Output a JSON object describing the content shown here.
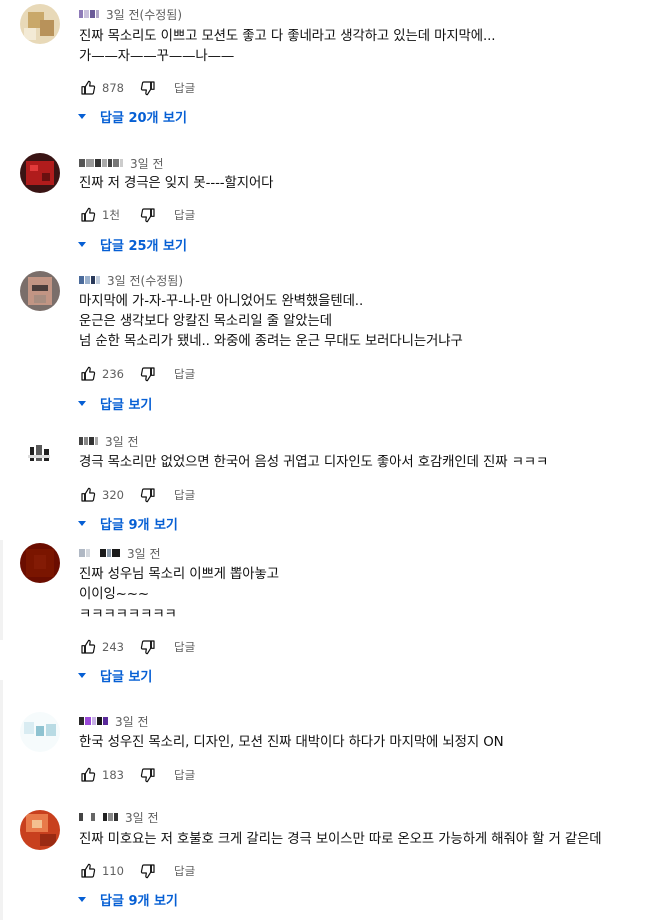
{
  "comments": [
    {
      "time": "3일 전(수정됨)",
      "text": "진짜 목소리도 이쁘고 모션도 좋고 다 좋네라고 생각하고 있는데 마지막에...\n가——자——꾸——나——",
      "likes": "878",
      "reply_label": "답글",
      "replies_label": "답글 20개 보기",
      "avatar_colors": [
        "#e8d9b8",
        "#c9a86a",
        "#f3ead5",
        "#b8925a"
      ]
    },
    {
      "time": "3일 전",
      "text": "진짜 저 경극은 잊지 못----할지어다",
      "likes": "1천",
      "reply_label": "답글",
      "replies_label": "답글 25개 보기",
      "avatar_colors": [
        "#3a1414",
        "#b01c1c",
        "#e23a3a",
        "#6a1010"
      ]
    },
    {
      "time": "3일 전(수정됨)",
      "text": "마지막에 가-자-꾸-나-만 아니었어도 완벽했을텐데..\n운근은 생각보다 앙칼진 목소리일 줄 알았는데\n넘 순한 목소리가 됐네.. 와중에 종려는 운근 무대도 보러다니는거냐구",
      "likes": "236",
      "reply_label": "답글",
      "replies_label": "답글 보기",
      "avatar_colors": [
        "#7a6e6a",
        "#c29584",
        "#4a3d3b",
        "#a88d80"
      ]
    },
    {
      "time": "3일 전",
      "text": "경극 목소리만 없었으면 한국어 음성 귀엽고 디자인도 좋아서 호감캐인데 진짜 ㅋㅋㅋ",
      "likes": "320",
      "reply_label": "답글",
      "replies_label": "답글 9개 보기",
      "avatar_colors": [
        "#ffffff",
        "#202020",
        "#dcdcdc",
        "#5a5a5a"
      ]
    },
    {
      "time": "3일 전",
      "text": "진짜 성우님 목소리 이쁘게 뽑아놓고\n이이잉~~~\nㅋㅋㅋㅋㅋㅋㅋㅋ",
      "likes": "243",
      "reply_label": "답글",
      "replies_label": "답글 보기",
      "avatar_colors": [
        "#6b0d00",
        "#7a1500",
        "#5a0a00",
        "#831b05"
      ]
    },
    {
      "time": "3일 전",
      "text": "한국 성우진 목소리, 디자인, 모션 진짜 대박이다 하다가 마지막에 뇌정지 ON",
      "likes": "183",
      "reply_label": "답글",
      "replies_label": "",
      "avatar_colors": [
        "#d9ecf2",
        "#8fc3d1",
        "#f6fbfc",
        "#b9dbe4"
      ]
    },
    {
      "time": "3일 전",
      "text": "진짜 미호요는 저 호불호 크게 갈리는 경극 보이스만 따로 온오프 가능하게 해줘야 할 거 같은데",
      "likes": "110",
      "reply_label": "답글",
      "replies_label": "답글 9개 보기",
      "avatar_colors": [
        "#c8401e",
        "#e87a4a",
        "#f3c090",
        "#9a2a12"
      ]
    }
  ],
  "colors": {
    "text": "#0f0f0f",
    "meta": "#606060",
    "link": "#065fd4",
    "icon": "#0f0f0f"
  },
  "icons": {
    "like": "thumbs-up-icon",
    "dislike": "thumbs-down-icon",
    "expand": "caret-down-icon"
  }
}
